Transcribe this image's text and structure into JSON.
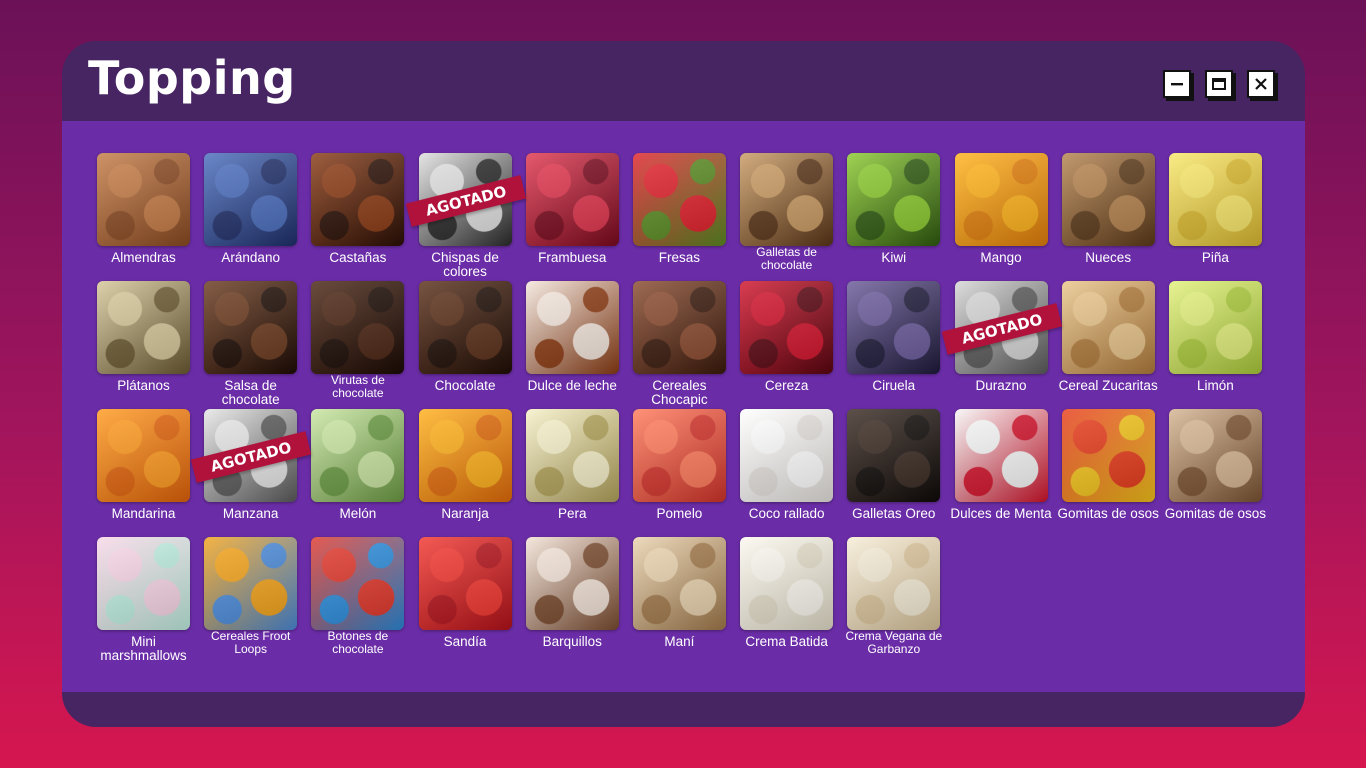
{
  "window": {
    "title": "Topping"
  },
  "status": {
    "sold_out": "AGOTADO"
  },
  "items": [
    {
      "label": "Almendras",
      "colors": [
        "#c47b45",
        "#8a4a22"
      ],
      "sold_out": false
    },
    {
      "label": "Arándano",
      "colors": [
        "#4a6dbd",
        "#1f2f6a"
      ],
      "sold_out": false
    },
    {
      "label": "Castañas",
      "colors": [
        "#8a3a14",
        "#2a0f05"
      ],
      "sold_out": false
    },
    {
      "label": "Chispas de colores",
      "colors": [
        "#e0e0e0",
        "#2a2a2a"
      ],
      "sold_out": true
    },
    {
      "label": "Frambuesa",
      "colors": [
        "#e0344d",
        "#7a0a1e"
      ],
      "sold_out": false
    },
    {
      "label": "Fresas",
      "colors": [
        "#e0202a",
        "#5a8a22"
      ],
      "sold_out": false
    },
    {
      "label": "Galletas de chocolate",
      "colors": [
        "#c99a62",
        "#5a3518"
      ],
      "sold_out": false
    },
    {
      "label": "Kiwi",
      "colors": [
        "#8ac92e",
        "#2f5a10"
      ],
      "sold_out": false
    },
    {
      "label": "Mango",
      "colors": [
        "#ffb21a",
        "#e07d0a"
      ],
      "sold_out": false
    },
    {
      "label": "Nueces",
      "colors": [
        "#b5834e",
        "#5c3a1a"
      ],
      "sold_out": false
    },
    {
      "label": "Piña",
      "colors": [
        "#f9e76a",
        "#d9b82e"
      ],
      "sold_out": false
    },
    {
      "label": "Plátanos",
      "colors": [
        "#d6c79a",
        "#6b5a32"
      ],
      "sold_out": false
    },
    {
      "label": "Salsa de chocolate",
      "colors": [
        "#6b3a1e",
        "#1e0c05"
      ],
      "sold_out": false
    },
    {
      "label": "Virutas de chocolate",
      "colors": [
        "#4a2412",
        "#1a0a04"
      ],
      "sold_out": false
    },
    {
      "label": "Chocolate",
      "colors": [
        "#5a2e18",
        "#1e0d05"
      ],
      "sold_out": false
    },
    {
      "label": "Dulce de leche",
      "colors": [
        "#f4e6dc",
        "#8a3a12"
      ],
      "sold_out": false
    },
    {
      "label": "Cereales Chocapic",
      "colors": [
        "#8a4a2e",
        "#3a1a0c"
      ],
      "sold_out": false
    },
    {
      "label": "Cereza",
      "colors": [
        "#d1122a",
        "#5a0510"
      ],
      "sold_out": false
    },
    {
      "label": "Ciruela",
      "colors": [
        "#6a5a9a",
        "#1e1a3a"
      ],
      "sold_out": false
    },
    {
      "label": "Durazno",
      "colors": [
        "#d6d6d6",
        "#5a5a5a"
      ],
      "sold_out": true
    },
    {
      "label": "Cereal Zucaritas",
      "colors": [
        "#e9c58a",
        "#b07a3a"
      ],
      "sold_out": false
    },
    {
      "label": "Limón",
      "colors": [
        "#e2f07a",
        "#a9c93a"
      ],
      "sold_out": false
    },
    {
      "label": "Mandarina",
      "colors": [
        "#ff9a1f",
        "#e0620a"
      ],
      "sold_out": false
    },
    {
      "label": "Manzana",
      "colors": [
        "#e6e6e6",
        "#5a5a5a"
      ],
      "sold_out": true
    },
    {
      "label": "Melón",
      "colors": [
        "#c9e6a2",
        "#6a9a42"
      ],
      "sold_out": false
    },
    {
      "label": "Naranja",
      "colors": [
        "#ffb01a",
        "#e06a0a"
      ],
      "sold_out": false
    },
    {
      "label": "Pera",
      "colors": [
        "#f6f0c8",
        "#b2a25a"
      ],
      "sold_out": false
    },
    {
      "label": "Pomelo",
      "colors": [
        "#ff7a5a",
        "#d1332a"
      ],
      "sold_out": false
    },
    {
      "label": "Coco rallado",
      "colors": [
        "#ffffff",
        "#e4e0dc"
      ],
      "sold_out": false
    },
    {
      "label": "Galletas Oreo",
      "colors": [
        "#3a2a22",
        "#0e0a08"
      ],
      "sold_out": false
    },
    {
      "label": "Dulces de Menta",
      "colors": [
        "#f6f6f6",
        "#d1122a"
      ],
      "sold_out": false
    },
    {
      "label": "Gomitas de osos",
      "colors": [
        "#e63a1a",
        "#f2c21a"
      ],
      "sold_out": false
    },
    {
      "label": "Gomitas de osos",
      "colors": [
        "#d6b592",
        "#7a5232"
      ],
      "sold_out": false
    },
    {
      "label": "Mini marshmallows",
      "colors": [
        "#f8d6e6",
        "#bfeee0"
      ],
      "sold_out": false
    },
    {
      "label": "Cereales Froot Loops",
      "colors": [
        "#f2a21a",
        "#4a8ad9"
      ],
      "sold_out": false
    },
    {
      "label": "Botones de chocolate",
      "colors": [
        "#e0362a",
        "#2a8ad9"
      ],
      "sold_out": false
    },
    {
      "label": "Sandía",
      "colors": [
        "#f2352e",
        "#b3121a"
      ],
      "sold_out": false
    },
    {
      "label": "Barquillos",
      "colors": [
        "#f2e2d6",
        "#7a4a2e"
      ],
      "sold_out": false
    },
    {
      "label": "Maní",
      "colors": [
        "#e9d2ae",
        "#a0784a"
      ],
      "sold_out": false
    },
    {
      "label": "Crema Batida",
      "colors": [
        "#fbf8ef",
        "#e2dcc8"
      ],
      "sold_out": false
    },
    {
      "label": "Crema Vegana de Garbanzo",
      "colors": [
        "#f6ecd6",
        "#d9c39a"
      ],
      "sold_out": false
    }
  ]
}
